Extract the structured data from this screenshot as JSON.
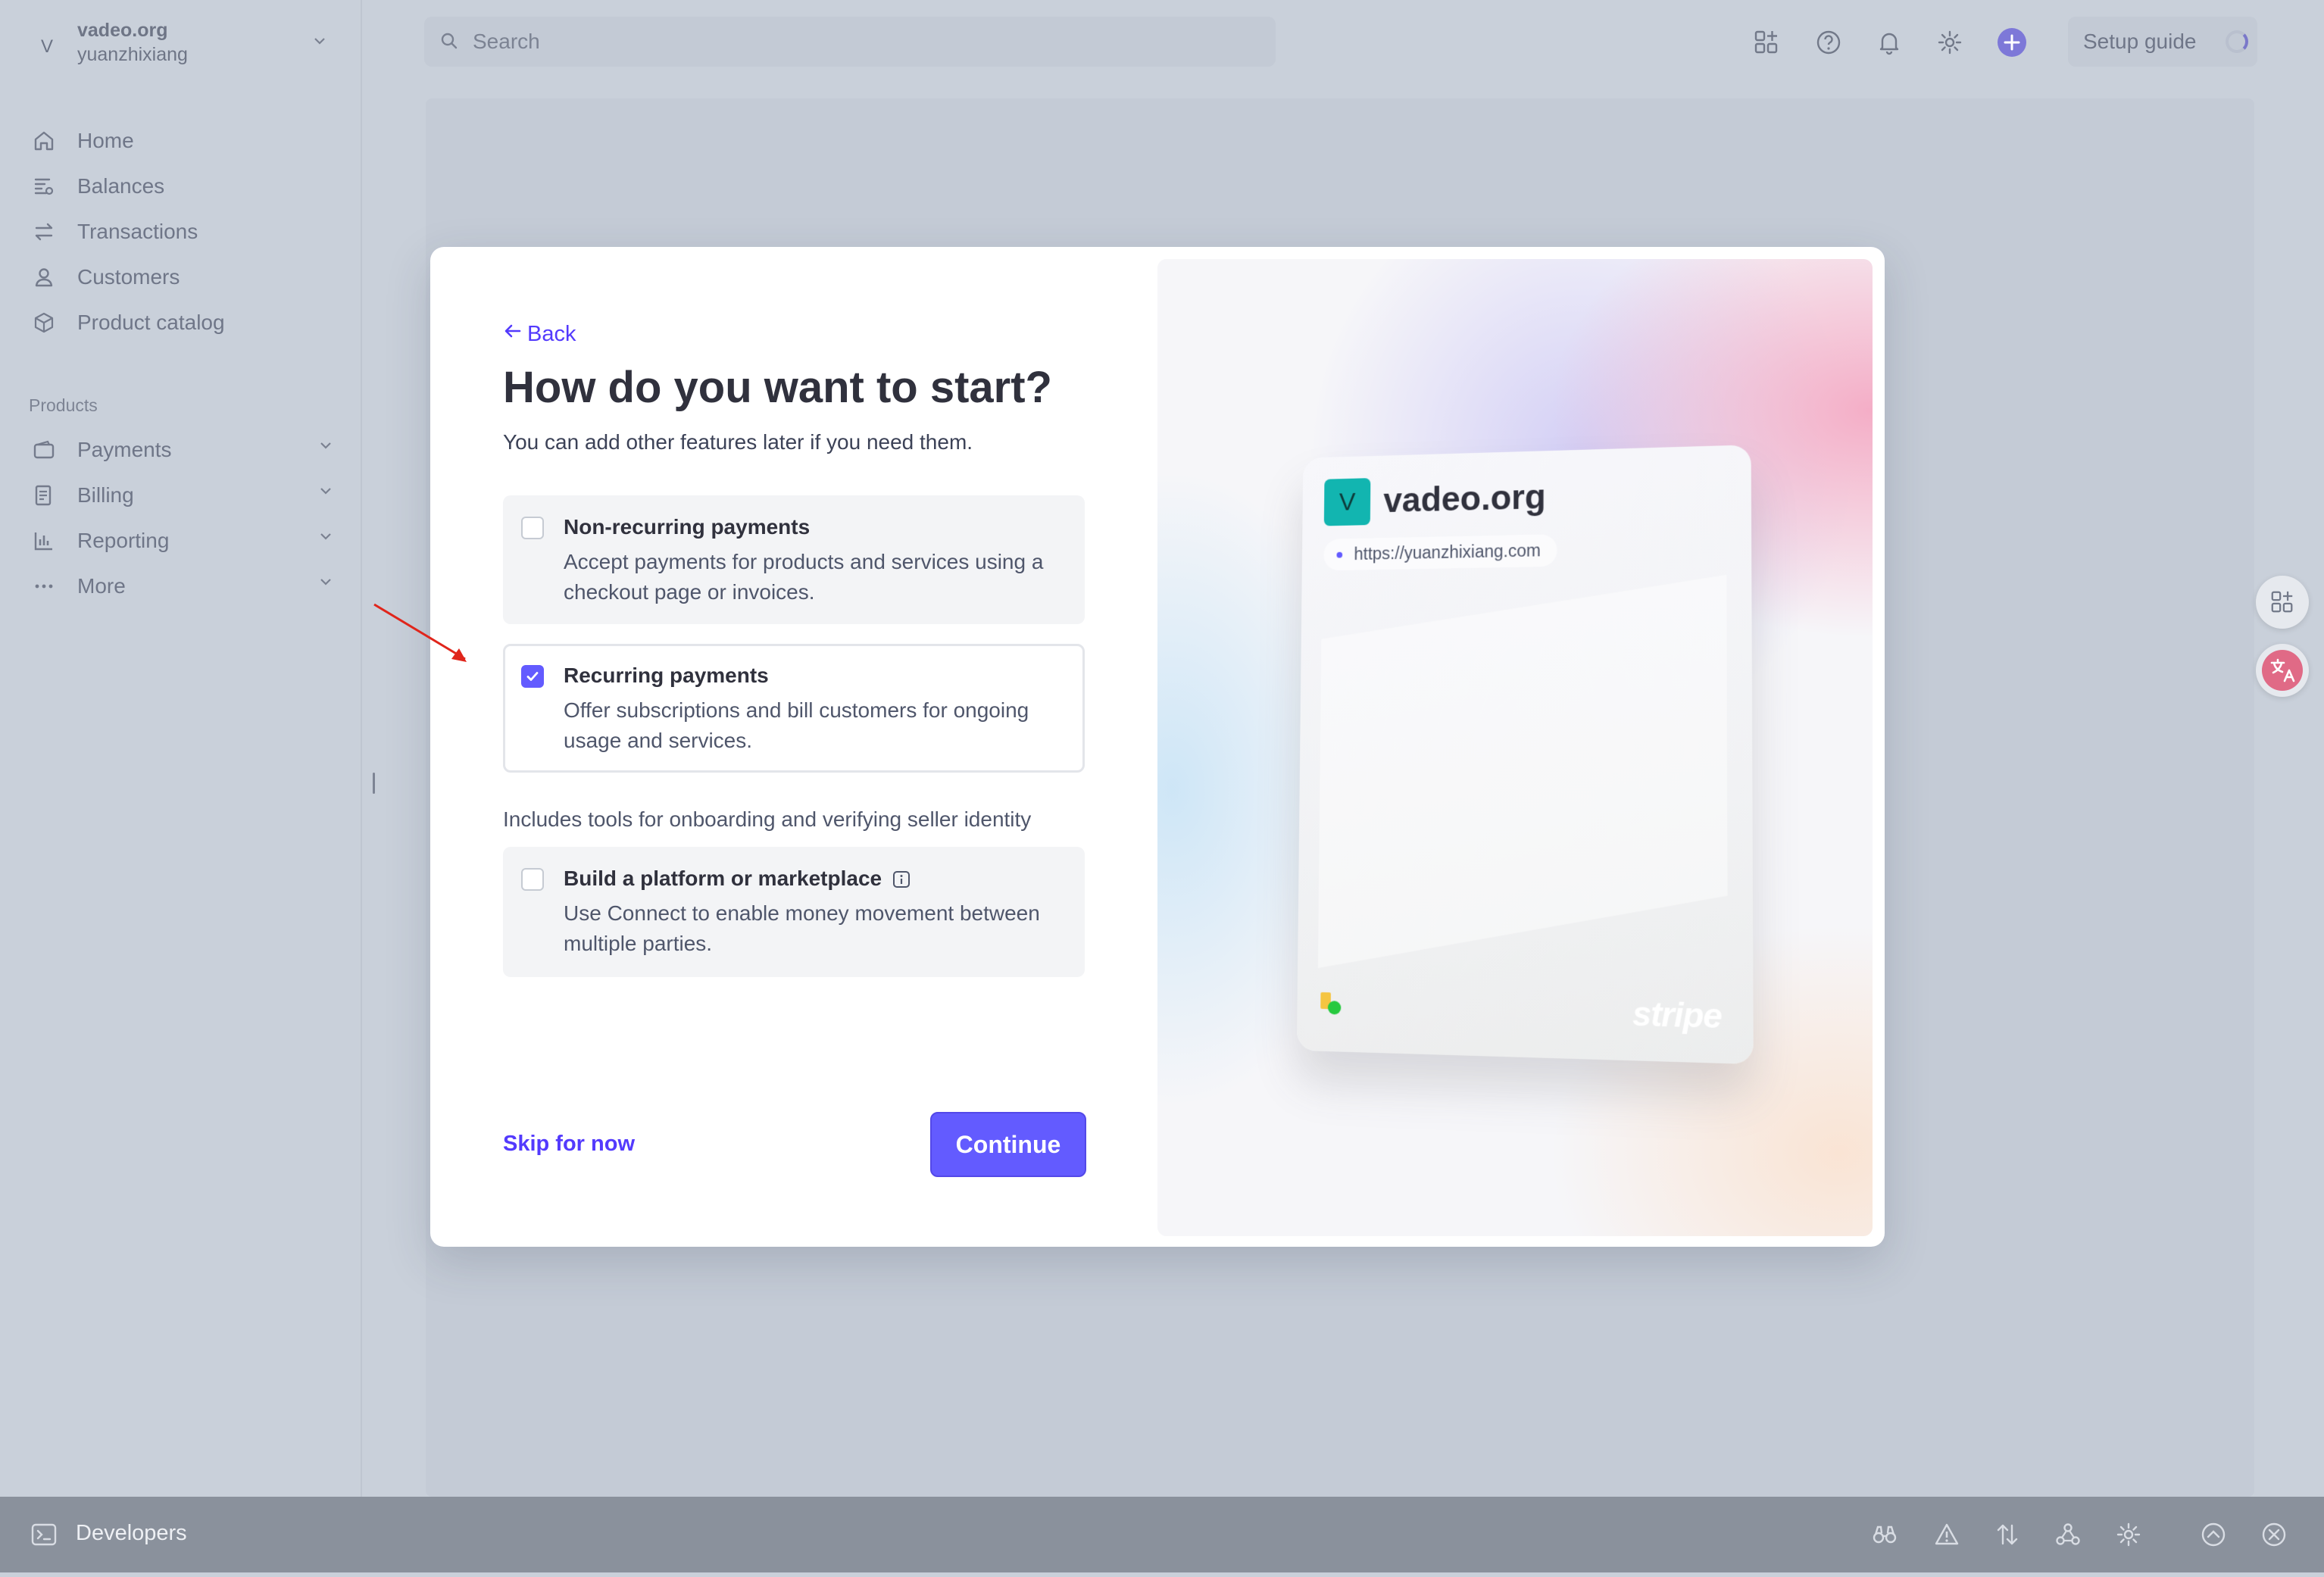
{
  "account": {
    "initial": "V",
    "name": "vadeo.org",
    "user": "yuanzhixiang"
  },
  "sidebar": {
    "items": [
      {
        "label": "Home",
        "icon": "home-icon"
      },
      {
        "label": "Balances",
        "icon": "balances-icon"
      },
      {
        "label": "Transactions",
        "icon": "transactions-icon"
      },
      {
        "label": "Customers",
        "icon": "customers-icon"
      },
      {
        "label": "Product catalog",
        "icon": "product-catalog-icon"
      }
    ],
    "section_label": "Products",
    "product_items": [
      {
        "label": "Payments",
        "icon": "payments-icon"
      },
      {
        "label": "Billing",
        "icon": "billing-icon"
      },
      {
        "label": "Reporting",
        "icon": "reporting-icon"
      },
      {
        "label": "More",
        "icon": "more-icon"
      }
    ]
  },
  "topbar": {
    "search_placeholder": "Search",
    "setup_guide": "Setup guide",
    "icons": [
      "apps-icon",
      "help-icon",
      "notifications-icon",
      "settings-icon",
      "create-icon"
    ]
  },
  "modal": {
    "back": "Back",
    "title": "How do you want to start?",
    "subtitle": "You can add other features later if you need them.",
    "options": [
      {
        "title": "Non-recurring payments",
        "desc": "Accept payments for products and services using a checkout page or invoices.",
        "checked": false
      },
      {
        "title": "Recurring payments",
        "desc": "Offer subscriptions and bill customers for ongoing usage and services.",
        "checked": true
      },
      {
        "title": "Build a platform or marketplace",
        "desc": "Use Connect to enable money movement between multiple parties.",
        "checked": false
      }
    ],
    "note": "Includes tools for onboarding and verifying seller identity",
    "skip": "Skip for now",
    "continue": "Continue",
    "preview": {
      "logo_initial": "V",
      "name": "vadeo.org",
      "url": "https://yuanzhixiang.com",
      "brand": "stripe"
    }
  },
  "devbar": {
    "label": "Developers",
    "tools": [
      "inspect-icon",
      "warning-icon",
      "sort-icon",
      "webhooks-icon",
      "settings-icon",
      "expand-icon",
      "close-icon"
    ]
  },
  "colors": {
    "accent": "#635bff",
    "link": "#533afd",
    "overlay": "#c9d0da"
  }
}
